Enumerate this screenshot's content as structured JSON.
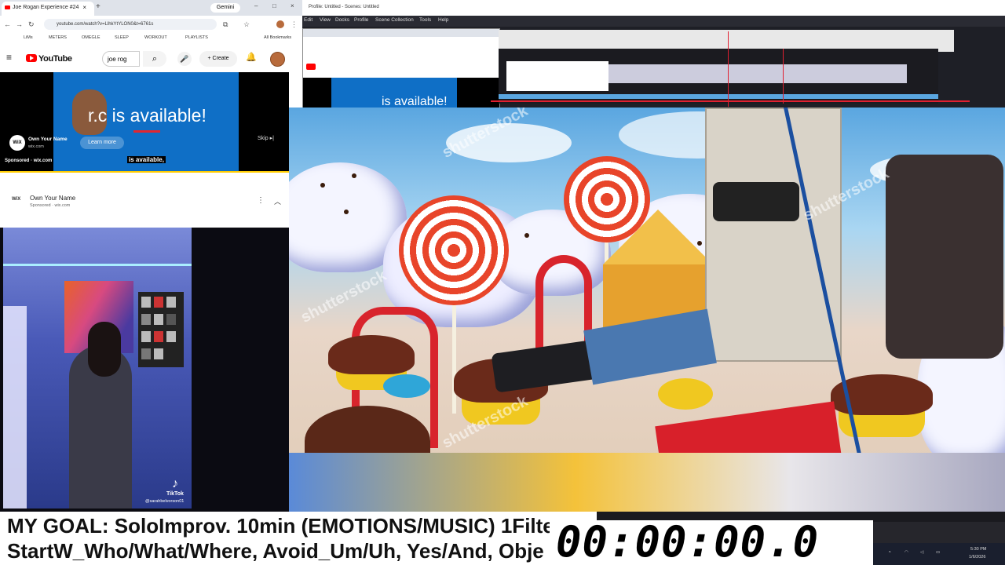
{
  "browser": {
    "tab_title": "Joe Rogan Experience #24",
    "gemini_label": "Gemini",
    "url": "youtube.com/watch?v=LlhkYtYLON0&t=6761s",
    "bookmarks": [
      "LiMs",
      "METERS",
      "OMEGLE",
      "SLEEP",
      "WORKOUT",
      "PLAYLISTS",
      "All Bookmarks"
    ],
    "youtube_label": "YouTube",
    "search_value": "joe rog",
    "create_label": "Create",
    "ad": {
      "headline": "is available!",
      "headline_prefix": "r.c",
      "advertiser": "Own Your Name",
      "domain": "wix.com",
      "learn_more": "Learn more",
      "skip": "Skip",
      "sponsored": "Sponsored",
      "caption": "is available,"
    },
    "sponsor_row": {
      "logo": "WiX",
      "title": "Own Your Name",
      "subtitle": "Sponsored · wix.com"
    }
  },
  "obs": {
    "title": "Profile: Untitled - Scenes: Untitled",
    "menu": [
      "Edit",
      "View",
      "Docks",
      "Profile",
      "Scene Collection",
      "Tools",
      "Help"
    ]
  },
  "scene": {
    "watermarks": [
      "shutterstock",
      "shutterstock",
      "shutterstock",
      "shutterstock"
    ]
  },
  "tiktok": {
    "logo": "TikTok",
    "username": "@sarahbelvorson01"
  },
  "goal": {
    "line1": "MY GOAL: SoloImprov. 10min (EMOTIONS/MUSIC) 1Filte",
    "line2": "StartW_Who/What/Where, Avoid_Um/Uh, Yes/And, Obje"
  },
  "timer": "00:00:00.0",
  "clock": {
    "time": "5:30 PM",
    "date": "1/6/2026"
  },
  "icons": [
    "youtube-icon",
    "search-icon",
    "mic-icon",
    "bell-icon",
    "kebab-icon",
    "chevron-up-icon",
    "tiktok-icon"
  ]
}
